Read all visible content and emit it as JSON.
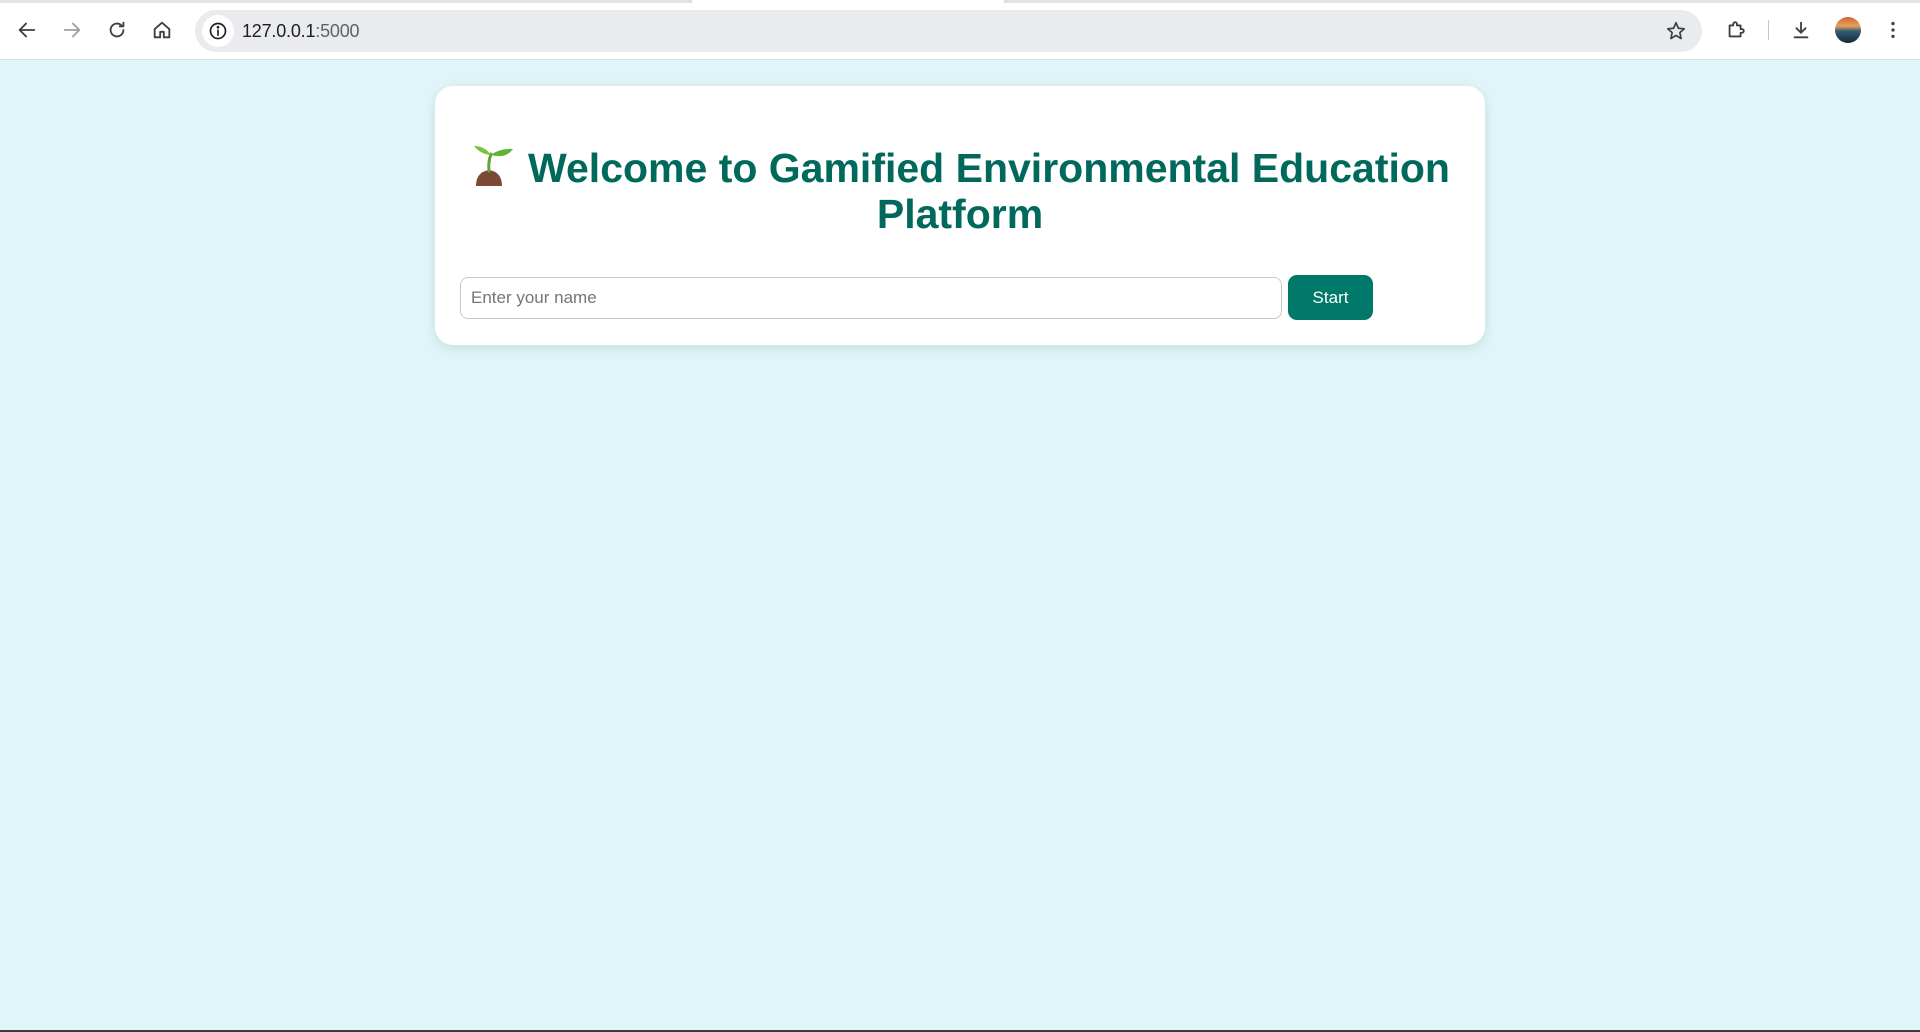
{
  "browser": {
    "url_host": "127.0.0.1",
    "url_port": ":5000",
    "icons": [
      "back-arrow-icon",
      "forward-arrow-icon",
      "reload-icon",
      "home-icon",
      "site-info-icon",
      "bookmark-star-icon",
      "extensions-puzzle-icon",
      "download-icon",
      "profile-avatar",
      "kebab-menu-icon"
    ]
  },
  "main": {
    "heading": "Welcome to Gamified Environmental Education Platform",
    "heading_icon": "sprout-icon",
    "name_input": {
      "placeholder": "Enter your name",
      "value": ""
    },
    "start_label": "Start"
  },
  "colors": {
    "page_background": "#dff5f7",
    "heading_text": "#00695c",
    "button_background": "#00796b",
    "card_background": "#ffffff"
  }
}
